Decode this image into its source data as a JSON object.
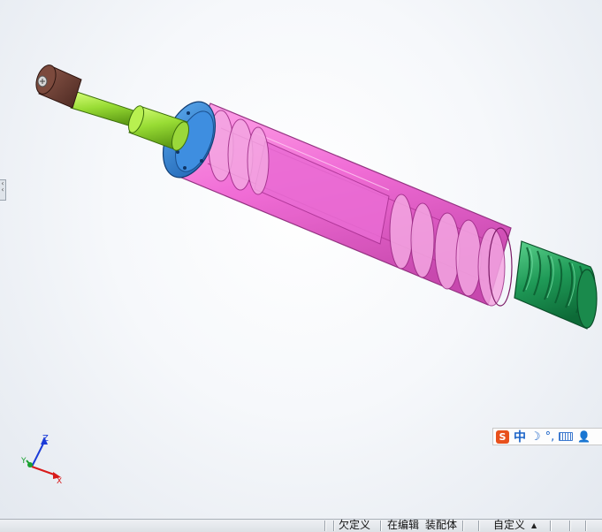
{
  "triad": {
    "z_label": "Z",
    "y_label": "Y",
    "x_label": "X"
  },
  "ime": {
    "logo": "S",
    "lang": "中",
    "moon": "☽",
    "punct": "°,",
    "user": "👤"
  },
  "status": {
    "constraint": "欠定义",
    "editing": "在编辑",
    "document": "装配体",
    "units": "自定义",
    "units_arrow": "▲"
  },
  "colors": {
    "body": "#f15ccf",
    "end_cap": "#2e86d6",
    "spring": "#1e9a58",
    "rod": "#9ee23a",
    "knob": "#6b3f34"
  }
}
